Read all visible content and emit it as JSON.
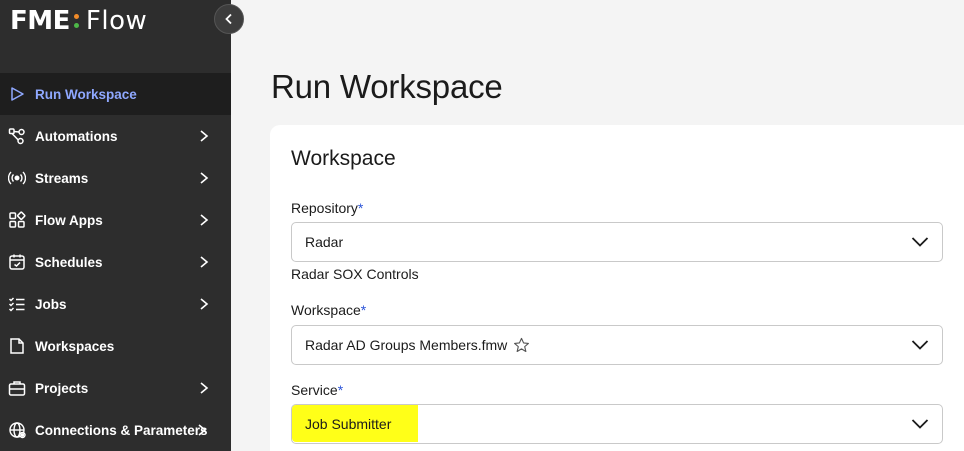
{
  "app": {
    "logo_fme": "FME",
    "logo_flow": "Flow"
  },
  "sidebar": {
    "items": [
      {
        "label": "Run Workspace",
        "icon": "play-icon",
        "active": true,
        "has_chevron": false
      },
      {
        "label": "Automations",
        "icon": "automations-icon",
        "active": false,
        "has_chevron": true
      },
      {
        "label": "Streams",
        "icon": "broadcast-icon",
        "active": false,
        "has_chevron": true
      },
      {
        "label": "Flow Apps",
        "icon": "apps-grid-icon",
        "active": false,
        "has_chevron": true
      },
      {
        "label": "Schedules",
        "icon": "calendar-icon",
        "active": false,
        "has_chevron": true
      },
      {
        "label": "Jobs",
        "icon": "checklist-icon",
        "active": false,
        "has_chevron": true
      },
      {
        "label": "Workspaces",
        "icon": "document-icon",
        "active": false,
        "has_chevron": false
      },
      {
        "label": "Projects",
        "icon": "briefcase-icon",
        "active": false,
        "has_chevron": true
      },
      {
        "label": "Connections & Parameters",
        "icon": "globe-icon",
        "active": false,
        "has_chevron": true
      }
    ]
  },
  "main": {
    "title": "Run Workspace",
    "card_title": "Workspace",
    "repository": {
      "label": "Repository",
      "required_mark": "*",
      "value": "Radar",
      "description": "Radar SOX Controls"
    },
    "workspace": {
      "label": "Workspace",
      "required_mark": "*",
      "value": "Radar AD Groups Members.fmw"
    },
    "service": {
      "label": "Service",
      "required_mark": "*",
      "value": "Job Submitter",
      "highlight_color": "#ffff18"
    }
  },
  "colors": {
    "sidebar_bg": "#2d2d2d",
    "active_text": "#8fa8ff",
    "required": "#2b54d8",
    "logo_orange": "#f08a28",
    "logo_green": "#4db848"
  }
}
